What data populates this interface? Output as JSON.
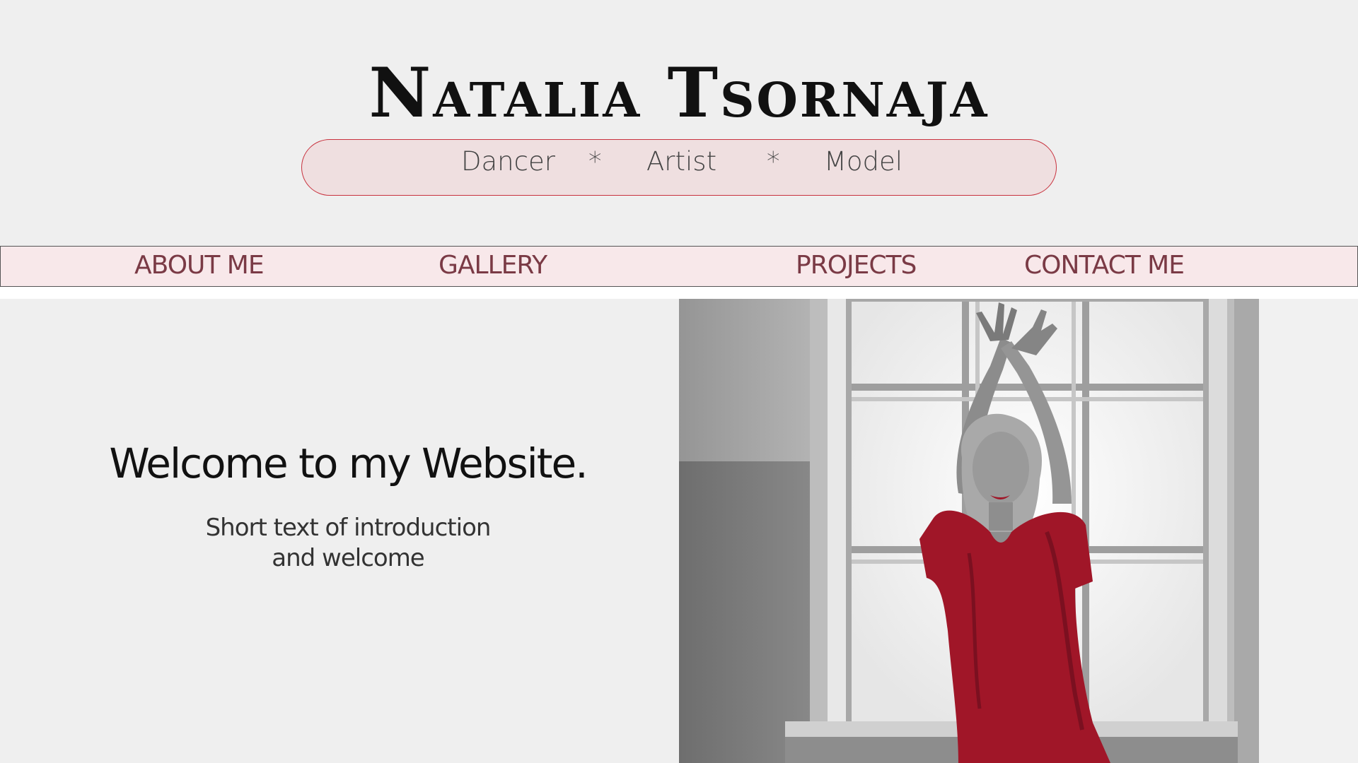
{
  "header": {
    "title": "Natalia Tsornaja",
    "tagline": {
      "items": [
        "Dancer",
        "*",
        "Artist",
        "*",
        "Model"
      ]
    }
  },
  "nav": {
    "items": [
      {
        "label": "ABOUT ME"
      },
      {
        "label": "GALLERY"
      },
      {
        "label": "PROJECTS"
      },
      {
        "label": "CONTACT ME"
      }
    ]
  },
  "intro": {
    "heading": "Welcome to my Website.",
    "text_line1": "Short text of introduction",
    "text_line2": "and welcome"
  },
  "hero": {
    "dress_color": "#a01628"
  },
  "colors": {
    "background": "#efefef",
    "accent_border": "#c8323e",
    "pill_fill": "#efdfe0",
    "nav_fill": "#f8e8ea",
    "nav_text": "#7a3a45"
  }
}
